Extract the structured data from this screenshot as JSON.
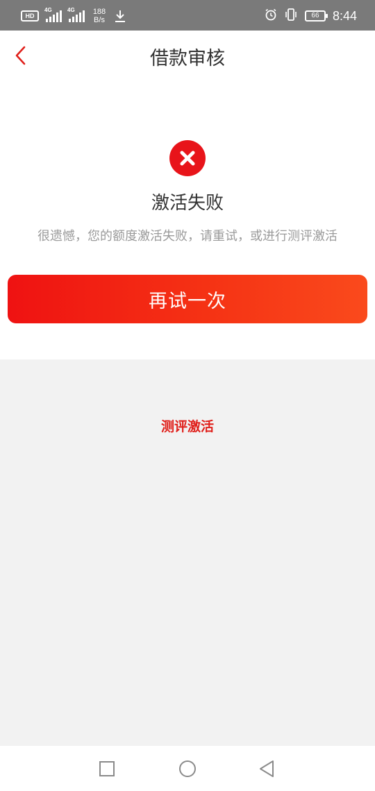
{
  "status_bar": {
    "hd": "HD",
    "network1": "4G",
    "network2": "4G",
    "speed_value": "188",
    "speed_unit": "B/s",
    "battery": "66",
    "time": "8:44"
  },
  "header": {
    "title": "借款审核"
  },
  "result": {
    "title": "激活失败",
    "description": "很遗憾，您的额度激活失败，请重试，或进行测评激活",
    "retry_label": "再试一次"
  },
  "secondary": {
    "eval_label": "测评激活"
  },
  "colors": {
    "accent": "#e0201b",
    "button_start": "#ef1212",
    "button_end": "#fa4a1c",
    "gray_bg": "#f2f2f2"
  },
  "icons": {
    "back": "chevron-left-icon",
    "fail": "close-circle-icon",
    "nav_recent": "square-icon",
    "nav_home": "circle-icon",
    "nav_back": "triangle-left-icon"
  }
}
